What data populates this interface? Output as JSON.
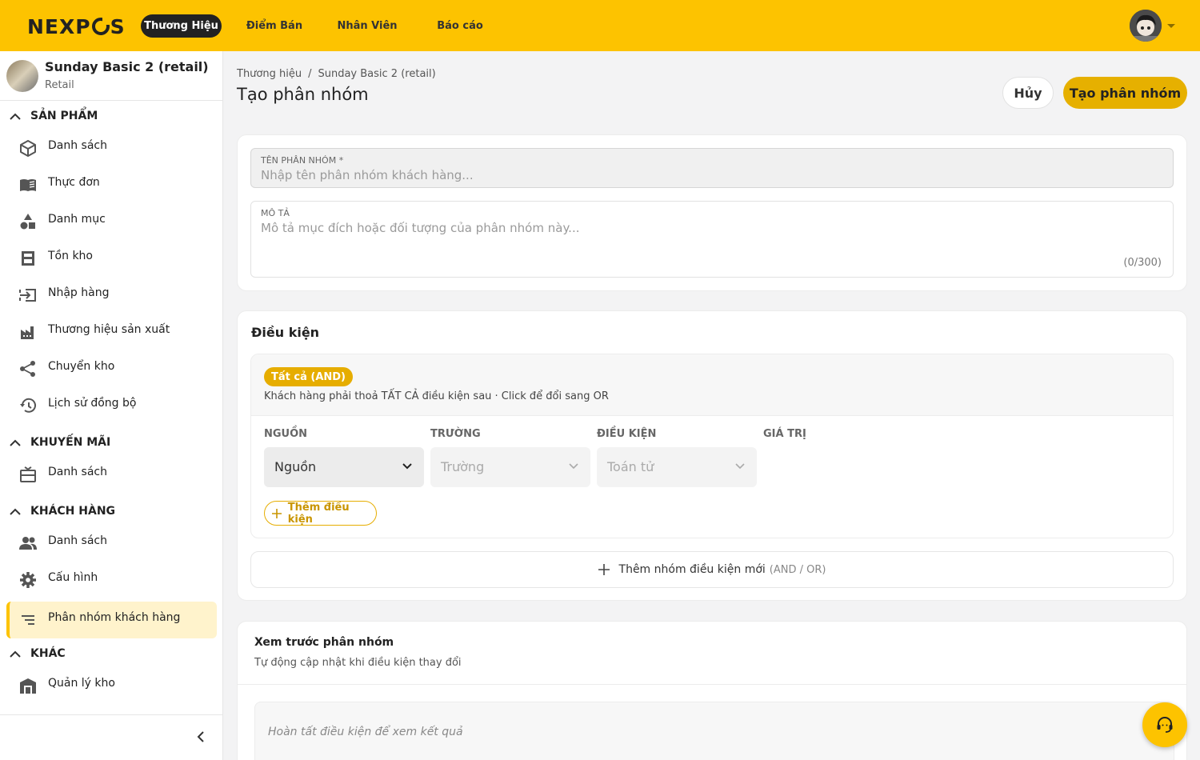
{
  "topbar": {
    "logo": "NEXPOS",
    "nav": [
      "Thương Hiệu",
      "Điểm Bán",
      "Nhân Viên",
      "Báo cáo"
    ]
  },
  "store": {
    "name": "Sunday Basic 2 (retail)",
    "type": "Retail"
  },
  "sidebar": {
    "sections": [
      {
        "title": "SẢN PHẨM",
        "items": [
          "Danh sách",
          "Thực đơn",
          "Danh mục",
          "Tồn kho",
          "Nhập hàng",
          "Thương hiệu sản xuất",
          "Chuyển kho",
          "Lịch sử đồng bộ"
        ]
      },
      {
        "title": "KHUYẾN MÃI",
        "items": [
          "Danh sách"
        ]
      },
      {
        "title": "KHÁCH HÀNG",
        "items": [
          "Danh sách",
          "Cấu hình",
          "Phân nhóm khách hàng"
        ]
      },
      {
        "title": "KHÁC",
        "items": [
          "Quản lý kho"
        ]
      }
    ],
    "active_item": "Phân nhóm khách hàng"
  },
  "breadcrumb": [
    "Thương hiệu",
    "/",
    "Sunday Basic 2 (retail)"
  ],
  "page_title": "Tạo phân nhóm",
  "actions": {
    "cancel": "Hủy",
    "create": "Tạo phân nhóm"
  },
  "form": {
    "name_label": "TÊN PHÂN NHÓM *",
    "name_placeholder": "Nhập tên phân nhóm khách hàng...",
    "desc_label": "MÔ TẢ",
    "desc_placeholder": "Mô tả mục đích hoặc đối tượng của phân nhóm này...",
    "desc_counter": "(0/300)"
  },
  "conditions": {
    "title": "Điều kiện",
    "group_badge": "Tất cả (AND)",
    "group_desc": "Khách hàng phải thoả TẤT CẢ điều kiện sau · Click để đổi sang OR",
    "columns": [
      "NGUỒN",
      "TRƯỜNG",
      "ĐIỀU KIỆN",
      "GIÁ TRỊ"
    ],
    "source_value": "Nguồn",
    "field_placeholder": "Trường",
    "operator_placeholder": "Toán tử",
    "add_condition": "Thêm điều kiện",
    "add_group": "Thêm nhóm điều kiện mới",
    "add_group_hint": "(AND / OR)"
  },
  "preview": {
    "title": "Xem trước phân nhóm",
    "subtitle": "Tự động cập nhật khi điều kiện thay đổi",
    "empty": "Hoàn tất điều kiện để xem kết quả"
  },
  "colors": {
    "brand": "#fdc300",
    "accent": "#e6b000"
  }
}
